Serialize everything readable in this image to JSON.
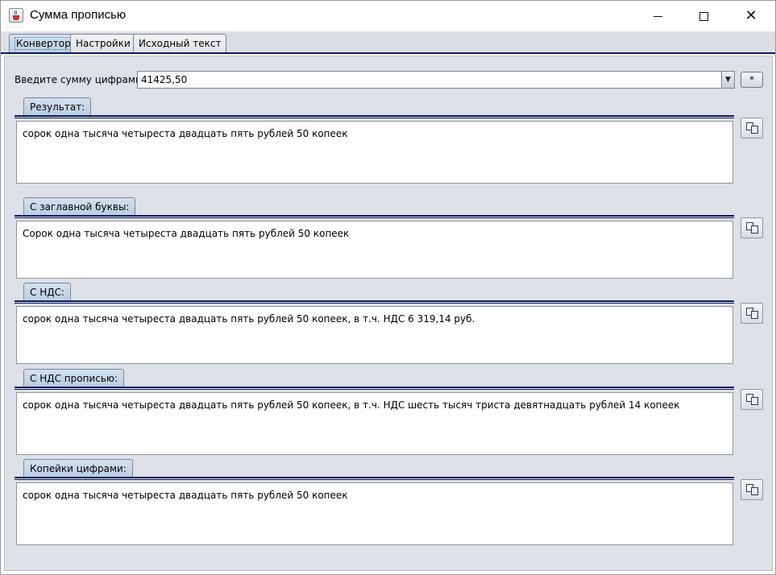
{
  "window": {
    "title": "Сумма прописью"
  },
  "tabs": [
    {
      "label": "Конвертор",
      "active": true
    },
    {
      "label": "Настройки",
      "active": false
    },
    {
      "label": "Исходный текст",
      "active": false
    }
  ],
  "amount": {
    "label": "Введите сумму цифрами:",
    "value": "41425,50",
    "star_label": "*"
  },
  "sections": [
    {
      "title": "Результат:",
      "text": "сорок одна тысяча четыреста двадцать пять рублей 50 копеек"
    },
    {
      "title": "С заглавной буквы:",
      "text": "Сорок одна тысяча четыреста двадцать пять рублей 50 копеек"
    },
    {
      "title": "С НДС:",
      "text": "сорок одна тысяча четыреста двадцать пять рублей 50 копеек, в т.ч. НДС 6 319,14 руб."
    },
    {
      "title": "С НДС прописью:",
      "text": "сорок одна тысяча четыреста двадцать пять рублей 50 копеек, в т.ч. НДС шесть тысяч триста девятнадцать рублей 14 копеек"
    },
    {
      "title": "Копейки цифрами:",
      "text": "сорок одна тысяча четыреста двадцать пять рублей 50 копеек"
    }
  ],
  "icons": {
    "app": "java-cup-icon",
    "copy": "copy-icon",
    "dropdown": "chevron-down-icon"
  },
  "colors": {
    "panel_bg": "#dde0e7",
    "rule": "#0c1a5a",
    "tab_active": "#b9cde1"
  }
}
